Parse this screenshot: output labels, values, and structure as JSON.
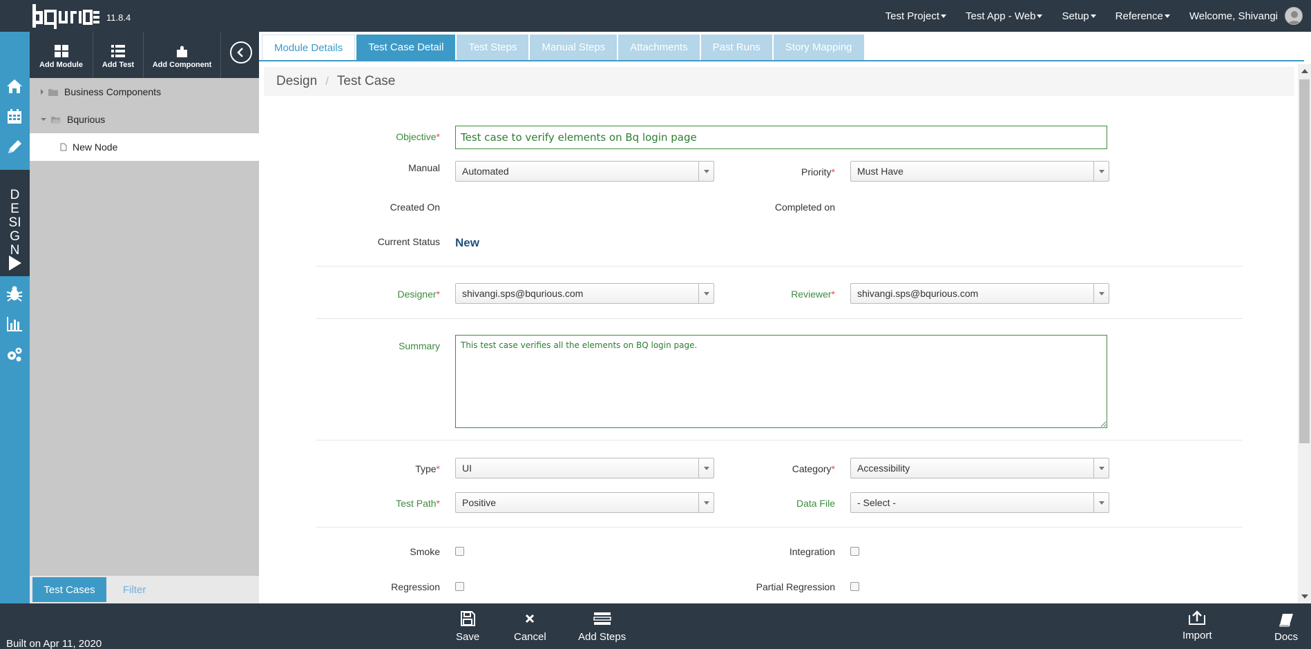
{
  "app": {
    "version": "11.8.4",
    "built": "Built on Apr 11, 2020"
  },
  "topnav": {
    "items": [
      "Test Project",
      "Test App - Web",
      "Setup",
      "Reference"
    ],
    "welcome": "Welcome, Shivangi"
  },
  "rail": {
    "design_label": [
      "D",
      "E",
      "SI",
      "G",
      "N"
    ]
  },
  "panel": {
    "toolbar": {
      "add_module": "Add Module",
      "add_test": "Add Test",
      "add_component": "Add Component"
    },
    "tree": [
      {
        "label": "Business Components"
      },
      {
        "label": "Bqurious"
      },
      {
        "label": "New Node"
      }
    ],
    "tabs": {
      "test_cases": "Test Cases",
      "filter": "Filter"
    }
  },
  "tabs": [
    "Module Details",
    "Test Case Detail",
    "Test Steps",
    "Manual Steps",
    "Attachments",
    "Past Runs",
    "Story Mapping"
  ],
  "breadcrumb": {
    "root": "Design",
    "sep": "/",
    "current": "Test Case"
  },
  "form": {
    "objective": {
      "label": "Objective",
      "value": "Test case to verify elements on Bq login page"
    },
    "manual": {
      "label": "Manual",
      "value": "Automated"
    },
    "priority": {
      "label": "Priority",
      "value": "Must Have"
    },
    "created_on": {
      "label": "Created On"
    },
    "completed_on": {
      "label": "Completed on"
    },
    "current_status": {
      "label": "Current Status",
      "value": "New"
    },
    "designer": {
      "label": "Designer",
      "value": "shivangi.sps@bqurious.com"
    },
    "reviewer": {
      "label": "Reviewer",
      "value": "shivangi.sps@bqurious.com"
    },
    "summary": {
      "label": "Summary",
      "value": "This test case verifies all the elements on BQ login page."
    },
    "type": {
      "label": "Type",
      "value": "UI"
    },
    "category": {
      "label": "Category",
      "value": "Accessibility"
    },
    "test_path": {
      "label": "Test Path",
      "value": "Positive"
    },
    "data_file": {
      "label": "Data File",
      "value": "- Select -"
    },
    "smoke": {
      "label": "Smoke"
    },
    "integration": {
      "label": "Integration"
    },
    "regression": {
      "label": "Regression"
    },
    "partial_regression": {
      "label": "Partial Regression"
    },
    "required_mark": "*"
  },
  "bottom": {
    "save": "Save",
    "cancel": "Cancel",
    "add_steps": "Add Steps",
    "import": "Import",
    "docs": "Docs"
  },
  "colors": {
    "navy": "#2d3945",
    "accent": "#3d9ac7",
    "green_label": "#3c8b3c",
    "required": "#d9534f"
  }
}
